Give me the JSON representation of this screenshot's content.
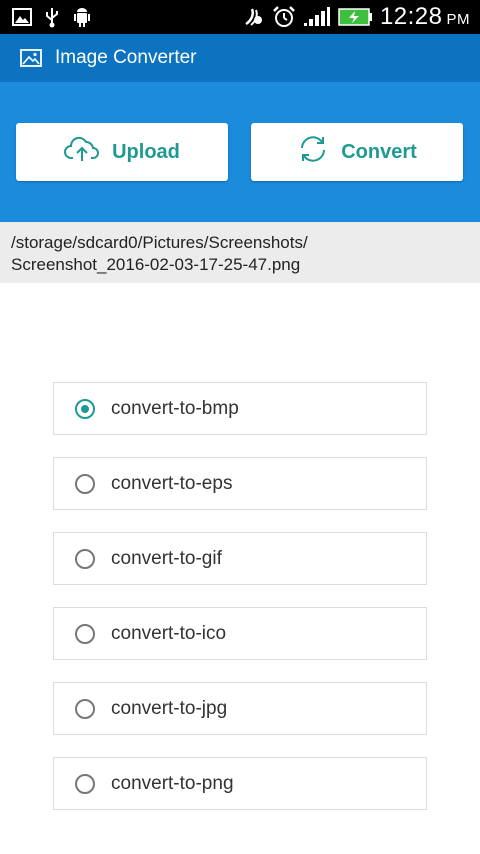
{
  "status_bar": {
    "time": "12:28",
    "ampm": "PM",
    "icons_left": [
      "image-icon",
      "usb-icon",
      "android-debug-icon"
    ],
    "icons_right": [
      "nfc-icon",
      "alarm-icon",
      "signal-icon",
      "battery-charging-icon"
    ]
  },
  "app_bar": {
    "title": "Image Converter",
    "icon": "image-icon"
  },
  "toolbar": {
    "upload_label": "Upload",
    "upload_icon": "cloud-upload-icon",
    "convert_label": "Convert",
    "convert_icon": "refresh-icon",
    "background": "#1b8bdc",
    "accent": "#1f9a93"
  },
  "file": {
    "path": "/storage/sdcard0/Pictures/Screenshots/\nScreenshot_2016-02-03-17-25-47.png"
  },
  "options": [
    {
      "label": "convert-to-bmp",
      "selected": true
    },
    {
      "label": "convert-to-eps",
      "selected": false
    },
    {
      "label": "convert-to-gif",
      "selected": false
    },
    {
      "label": "convert-to-ico",
      "selected": false
    },
    {
      "label": "convert-to-jpg",
      "selected": false
    },
    {
      "label": "convert-to-png",
      "selected": false
    }
  ]
}
